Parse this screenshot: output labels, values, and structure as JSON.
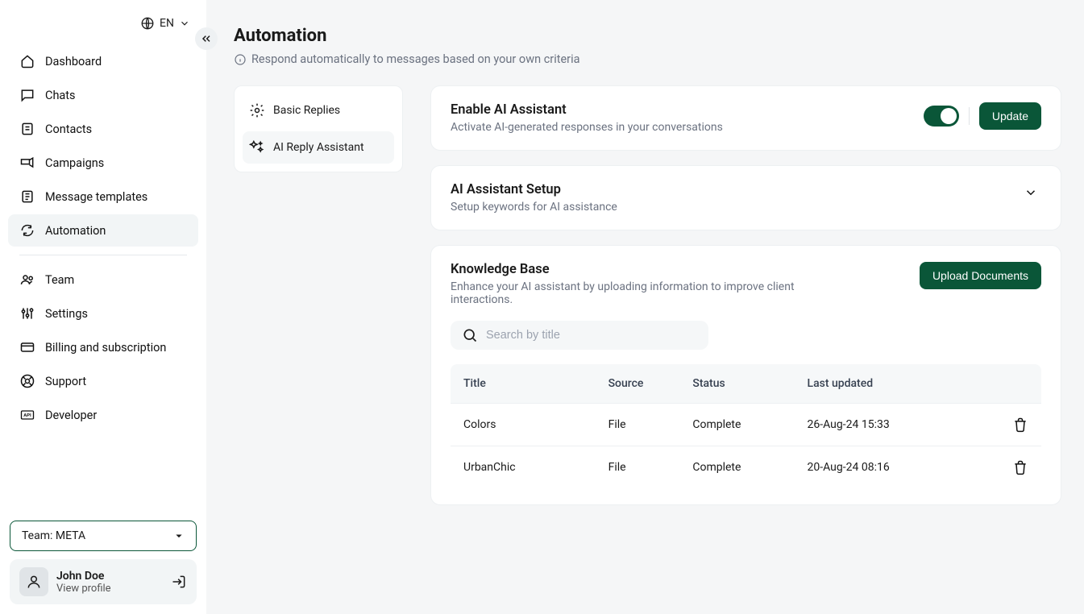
{
  "lang": {
    "label": "EN"
  },
  "sidebar": {
    "items": [
      {
        "label": "Dashboard",
        "name": "sidebar-item-dashboard"
      },
      {
        "label": "Chats",
        "name": "sidebar-item-chats"
      },
      {
        "label": "Contacts",
        "name": "sidebar-item-contacts"
      },
      {
        "label": "Campaigns",
        "name": "sidebar-item-campaigns"
      },
      {
        "label": "Message templates",
        "name": "sidebar-item-message-templates"
      },
      {
        "label": "Automation",
        "name": "sidebar-item-automation"
      },
      {
        "label": "Team",
        "name": "sidebar-item-team"
      },
      {
        "label": "Settings",
        "name": "sidebar-item-settings"
      },
      {
        "label": "Billing and subscription",
        "name": "sidebar-item-billing"
      },
      {
        "label": "Support",
        "name": "sidebar-item-support"
      },
      {
        "label": "Developer",
        "name": "sidebar-item-developer"
      }
    ]
  },
  "team_select": {
    "label": "Team: META"
  },
  "profile": {
    "name": "John Doe",
    "sub": "View profile"
  },
  "page": {
    "title": "Automation",
    "subtitle": "Respond automatically to messages based on your own criteria"
  },
  "subnav": {
    "basic": "Basic Replies",
    "ai": "AI Reply Assistant"
  },
  "panels": {
    "enable": {
      "title": "Enable AI Assistant",
      "sub": "Activate AI-generated responses in your conversations",
      "update_btn": "Update",
      "toggle_on": true
    },
    "setup": {
      "title": "AI Assistant Setup",
      "sub": "Setup keywords for AI assistance"
    },
    "kb": {
      "title": "Knowledge Base",
      "sub": "Enhance your AI assistant by uploading information to improve client interactions.",
      "upload_btn": "Upload Documents",
      "search_placeholder": "Search by title",
      "columns": {
        "title": "Title",
        "source": "Source",
        "status": "Status",
        "updated": "Last updated"
      },
      "rows": [
        {
          "title": "Colors",
          "source": "File",
          "status": "Complete",
          "updated": "26-Aug-24 15:33"
        },
        {
          "title": "UrbanChic",
          "source": "File",
          "status": "Complete",
          "updated": "20-Aug-24 08:16"
        }
      ]
    }
  }
}
